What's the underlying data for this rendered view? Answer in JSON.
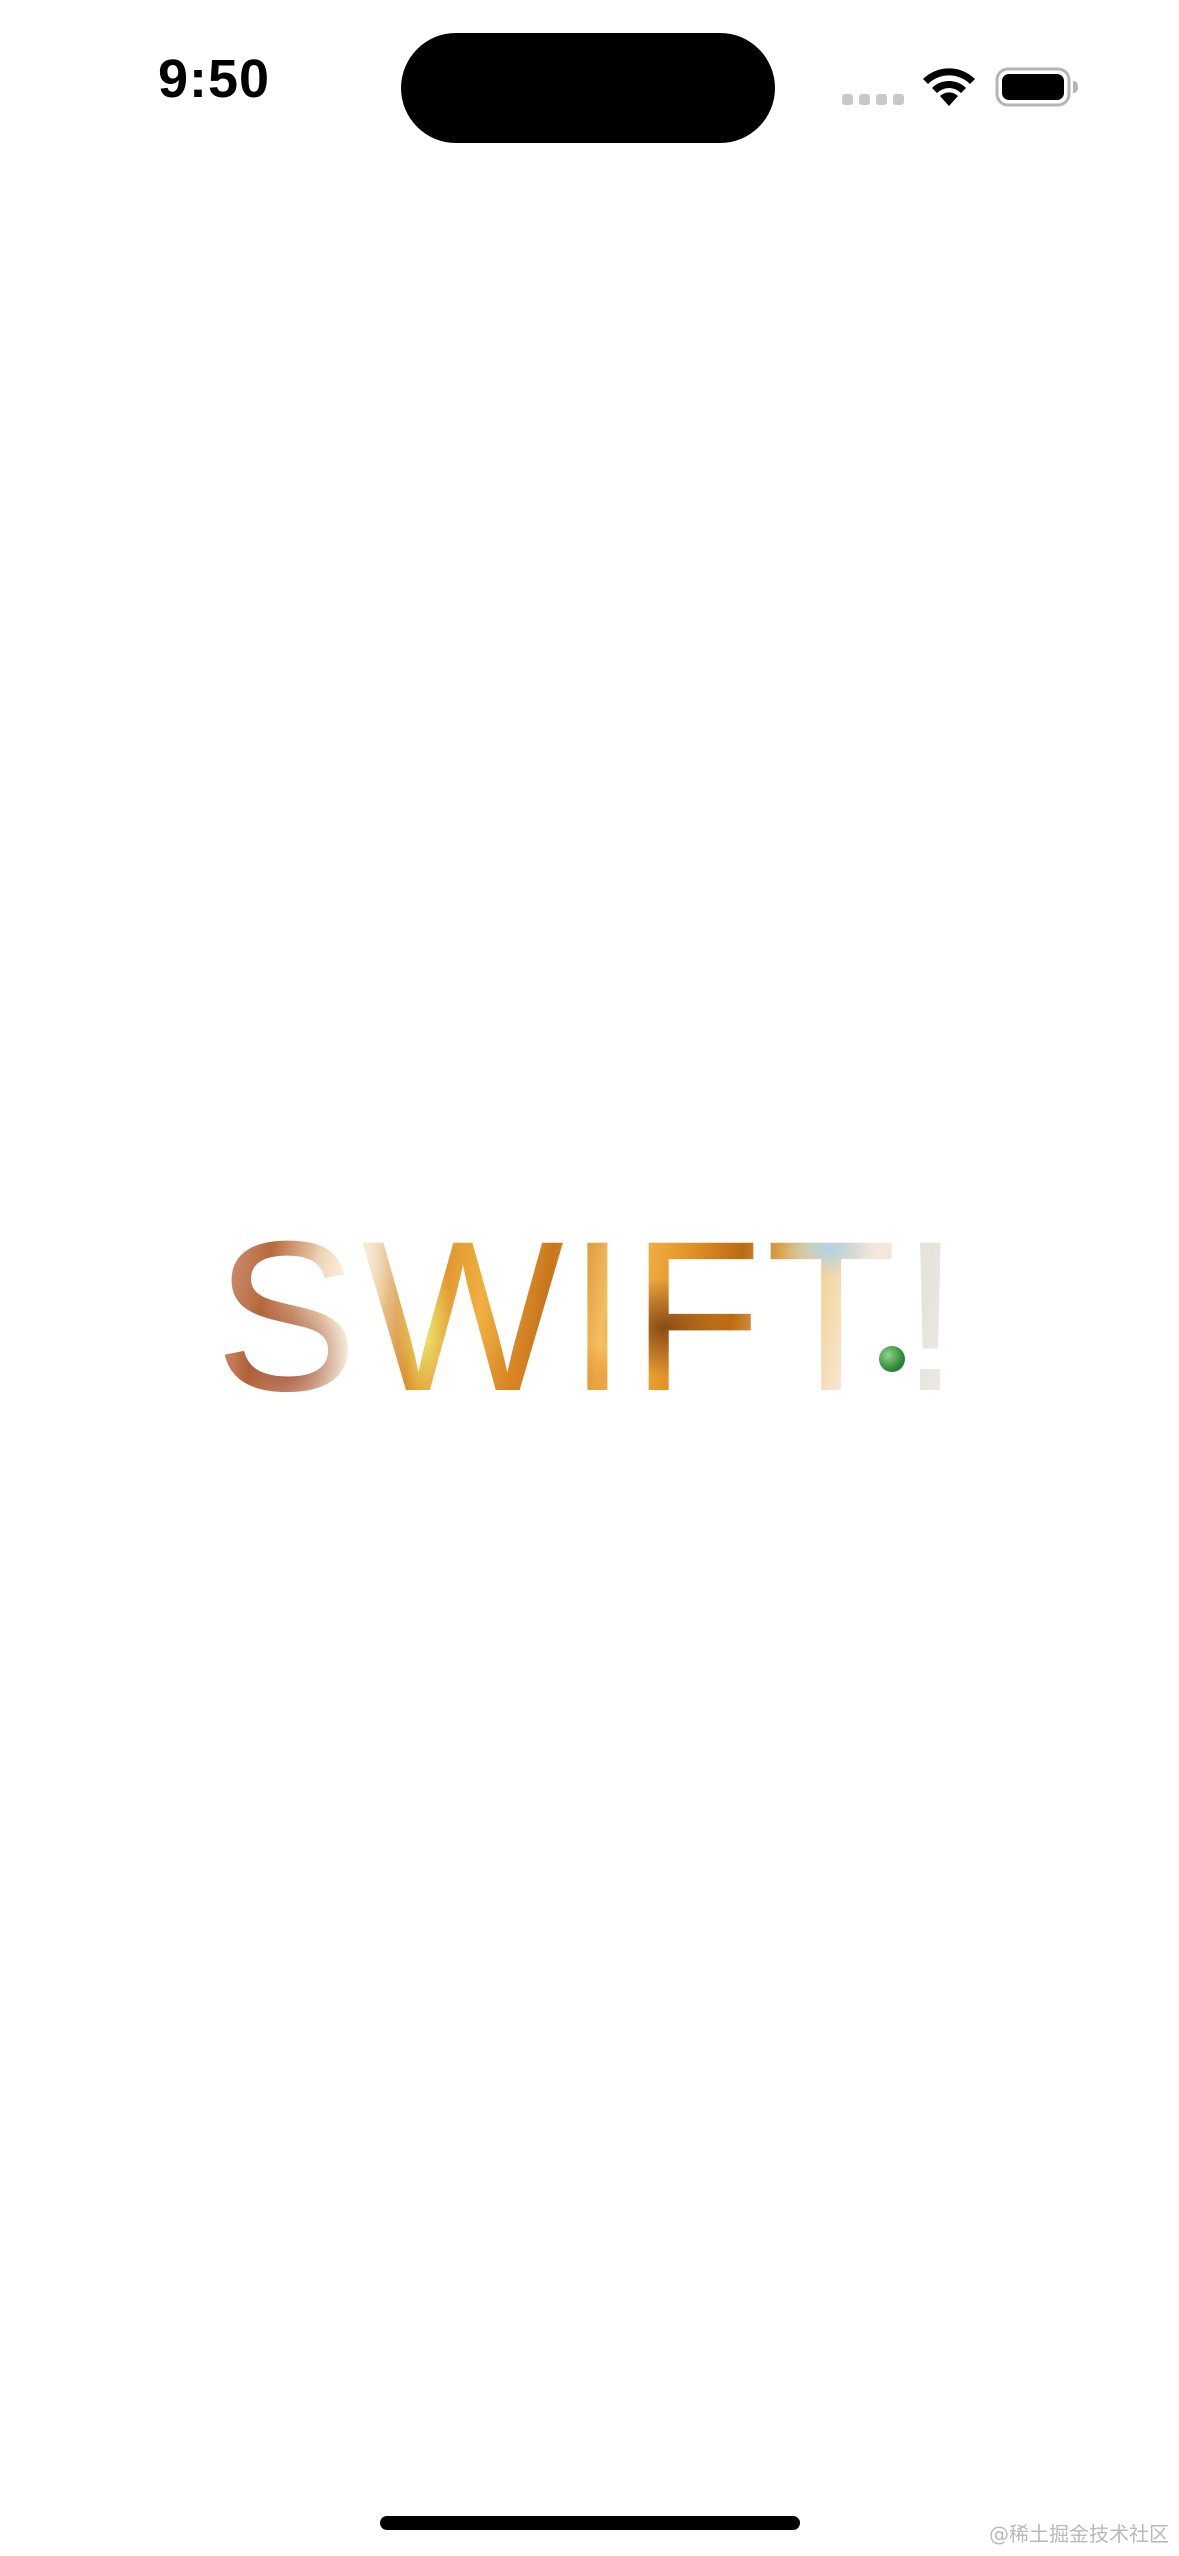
{
  "status_bar": {
    "time": "9:50",
    "icons": [
      "signal-dots-icon",
      "wifi-icon",
      "battery-icon"
    ]
  },
  "main": {
    "headline": "SWIFT!",
    "headline_fill": "photo-texture (orange/amber tones)",
    "accent_dot_color": "#2f8a3a"
  },
  "watermark": {
    "text": "@稀土掘金技术社区"
  },
  "colors": {
    "background": "#ffffff",
    "status_text": "#000000",
    "watermark": "#b9b9b9"
  }
}
